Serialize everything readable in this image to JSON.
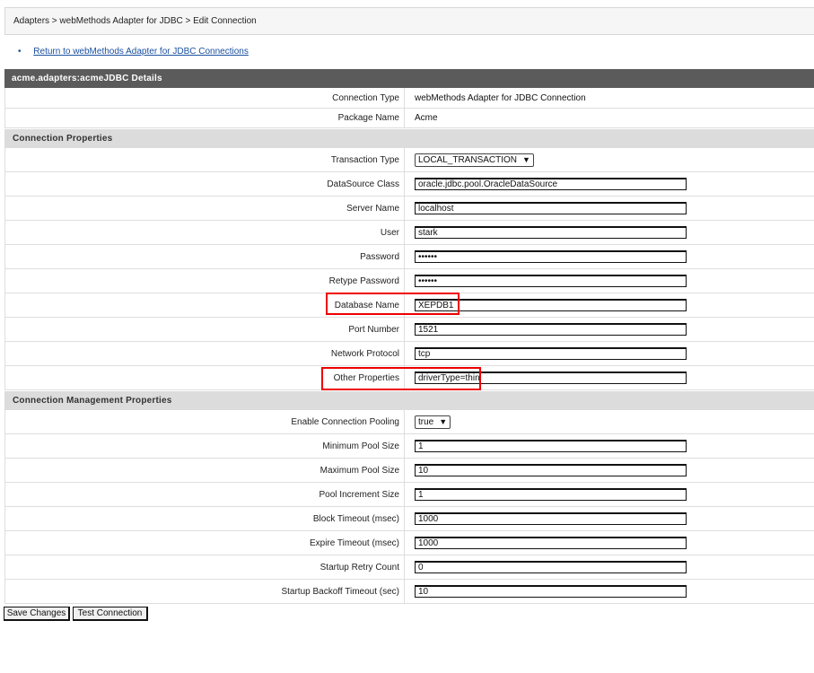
{
  "breadcrumb": "Adapters > webMethods Adapter for JDBC > Edit Connection",
  "return_link": "Return to webMethods Adapter for JDBC Connections",
  "panel_title": "acme.adapters:acmeJDBC Details",
  "info": [
    {
      "label": "Connection Type",
      "value": "webMethods Adapter for JDBC Connection"
    },
    {
      "label": "Package Name",
      "value": "Acme"
    }
  ],
  "connection_properties": {
    "title": "Connection Properties",
    "transaction_type": {
      "label": "Transaction Type",
      "value": "LOCAL_TRANSACTION"
    },
    "datasource_class": {
      "label": "DataSource Class",
      "value": "oracle.jdbc.pool.OracleDataSource"
    },
    "server_name": {
      "label": "Server Name",
      "value": "localhost"
    },
    "user": {
      "label": "User",
      "value": "stark"
    },
    "password": {
      "label": "Password",
      "value": "••••••"
    },
    "retype_password": {
      "label": "Retype Password",
      "value": "••••••"
    },
    "database_name": {
      "label": "Database Name",
      "value": "XEPDB1"
    },
    "port_number": {
      "label": "Port Number",
      "value": "1521"
    },
    "network_protocol": {
      "label": "Network Protocol",
      "value": "tcp"
    },
    "other_properties": {
      "label": "Other Properties",
      "value": "driverType=thin"
    }
  },
  "management": {
    "title": "Connection Management Properties",
    "enable_pooling": {
      "label": "Enable Connection Pooling",
      "value": "true"
    },
    "min_pool": {
      "label": "Minimum Pool Size",
      "value": "1"
    },
    "max_pool": {
      "label": "Maximum Pool Size",
      "value": "10"
    },
    "pool_increment": {
      "label": "Pool Increment Size",
      "value": "1"
    },
    "block_timeout": {
      "label": "Block Timeout (msec)",
      "value": "1000"
    },
    "expire_timeout": {
      "label": "Expire Timeout (msec)",
      "value": "1000"
    },
    "startup_retry": {
      "label": "Startup Retry Count",
      "value": "0"
    },
    "startup_backoff": {
      "label": "Startup Backoff Timeout (sec)",
      "value": "10"
    }
  },
  "buttons": {
    "save": "Save Changes",
    "test": "Test Connection"
  },
  "colors": {
    "highlight": "#e00000",
    "header_bg": "#5b5b5b",
    "section_bg": "#dcdcdc",
    "link": "#1a50a0"
  }
}
